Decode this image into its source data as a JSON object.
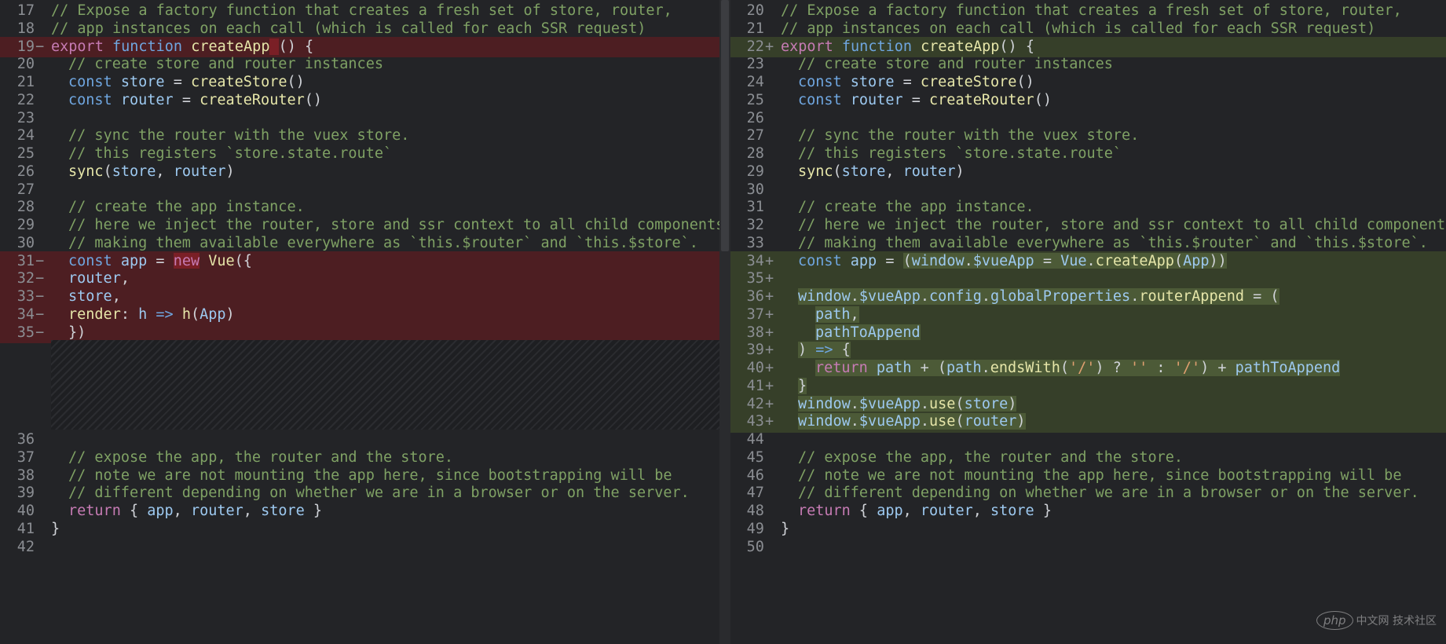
{
  "left": {
    "lines": [
      {
        "n": "17",
        "mark": "",
        "type": "ctx",
        "html": "<span class='c'>// Expose a factory function that creates a fresh set of store, router,</span>"
      },
      {
        "n": "18",
        "mark": "",
        "type": "ctx",
        "html": "<span class='c'>// app instances on each call (which is called for each SSR request)</span>"
      },
      {
        "n": "19",
        "mark": "−",
        "type": "del",
        "html": "<span class='k'>export</span> <span class='f'>function</span> <span class='fn'>createApp</span><span class='hl-del'> </span><span class='p'>() {</span>"
      },
      {
        "n": "20",
        "mark": "",
        "type": "ctx",
        "html": "<span class='ind'></span><span class='c'>// create store and router instances</span>"
      },
      {
        "n": "21",
        "mark": "",
        "type": "ctx",
        "html": "<span class='ind'></span><span class='f'>const</span> <span class='v'>store</span> <span class='p'>=</span> <span class='fn'>createStore</span><span class='p'>()</span>"
      },
      {
        "n": "22",
        "mark": "",
        "type": "ctx",
        "html": "<span class='ind'></span><span class='f'>const</span> <span class='v'>router</span> <span class='p'>=</span> <span class='fn'>createRouter</span><span class='p'>()</span>"
      },
      {
        "n": "23",
        "mark": "",
        "type": "ctx",
        "html": ""
      },
      {
        "n": "24",
        "mark": "",
        "type": "ctx",
        "html": "<span class='ind'></span><span class='c'>// sync the router with the vuex store.</span>"
      },
      {
        "n": "25",
        "mark": "",
        "type": "ctx",
        "html": "<span class='ind'></span><span class='c'>// this registers `store.state.route`</span>"
      },
      {
        "n": "26",
        "mark": "",
        "type": "ctx",
        "html": "<span class='ind'></span><span class='fn'>sync</span><span class='p'>(</span><span class='v'>store</span><span class='p'>, </span><span class='v'>router</span><span class='p'>)</span>"
      },
      {
        "n": "27",
        "mark": "",
        "type": "ctx",
        "html": ""
      },
      {
        "n": "28",
        "mark": "",
        "type": "ctx",
        "html": "<span class='ind'></span><span class='c'>// create the app instance.</span>"
      },
      {
        "n": "29",
        "mark": "",
        "type": "ctx",
        "html": "<span class='ind'></span><span class='c'>// here we inject the router, store and ssr context to all child components,</span>"
      },
      {
        "n": "30",
        "mark": "",
        "type": "ctx",
        "html": "<span class='ind'></span><span class='c'>// making them available everywhere as `this.$router` and `this.$store`.</span>"
      },
      {
        "n": "31",
        "mark": "−",
        "type": "del",
        "html": "<span class='ind'></span><span class='f'>const</span> <span class='v'>app</span> <span class='p'>=</span> <span class='hl-del'><span class='k'>new</span></span> <span class='fn'>Vue</span><span class='p'>({</span>"
      },
      {
        "n": "32",
        "mark": "−",
        "type": "del",
        "html": "<span class='ind hl-del'></span><span class='v'>router</span><span class='p'>,</span>"
      },
      {
        "n": "33",
        "mark": "−",
        "type": "del",
        "html": "<span class='ind hl-del'></span><span class='v'>store</span><span class='p'>,</span>"
      },
      {
        "n": "34",
        "mark": "−",
        "type": "del",
        "html": "<span class='ind hl-del'></span><span class='fn'>render</span><span class='p'>: </span><span class='v'>h</span> <span class='f'>=&gt;</span> <span class='fn'>h</span><span class='p'>(</span><span class='v'>App</span><span class='p'>)</span>"
      },
      {
        "n": "35",
        "mark": "−",
        "type": "del",
        "html": "<span class='ind'></span><span class='p'>})</span>"
      },
      {
        "n": "",
        "mark": "",
        "type": "gap",
        "html": ""
      },
      {
        "n": "",
        "mark": "",
        "type": "gap",
        "html": ""
      },
      {
        "n": "",
        "mark": "",
        "type": "gap",
        "html": ""
      },
      {
        "n": "",
        "mark": "",
        "type": "gap",
        "html": ""
      },
      {
        "n": "",
        "mark": "",
        "type": "gap",
        "html": ""
      },
      {
        "n": "36",
        "mark": "",
        "type": "ctx",
        "html": ""
      },
      {
        "n": "37",
        "mark": "",
        "type": "ctx",
        "html": "<span class='ind'></span><span class='c'>// expose the app, the router and the store.</span>"
      },
      {
        "n": "38",
        "mark": "",
        "type": "ctx",
        "html": "<span class='ind'></span><span class='c'>// note we are not mounting the app here, since bootstrapping will be</span>"
      },
      {
        "n": "39",
        "mark": "",
        "type": "ctx",
        "html": "<span class='ind'></span><span class='c'>// different depending on whether we are in a browser or on the server.</span>"
      },
      {
        "n": "40",
        "mark": "",
        "type": "ctx",
        "html": "<span class='ind'></span><span class='k'>return</span> <span class='p'>{ </span><span class='v'>app</span><span class='p'>, </span><span class='v'>router</span><span class='p'>, </span><span class='v'>store</span><span class='p'> }</span>"
      },
      {
        "n": "41",
        "mark": "",
        "type": "ctx",
        "html": "<span class='p'>}</span>"
      },
      {
        "n": "42",
        "mark": "",
        "type": "ctx",
        "html": ""
      }
    ]
  },
  "right": {
    "lines": [
      {
        "n": "20",
        "mark": "",
        "type": "ctx",
        "html": "<span class='c'>// Expose a factory function that creates a fresh set of store, router,</span>"
      },
      {
        "n": "21",
        "mark": "",
        "type": "ctx",
        "html": "<span class='c'>// app instances on each call (which is called for each SSR request)</span>"
      },
      {
        "n": "22",
        "mark": "+",
        "type": "add",
        "html": "<span class='k'>export</span> <span class='f'>function</span> <span class='fn'>createApp</span><span class='p'>() {</span>"
      },
      {
        "n": "23",
        "mark": "",
        "type": "ctx",
        "html": "<span class='ind'></span><span class='c'>// create store and router instances</span>"
      },
      {
        "n": "24",
        "mark": "",
        "type": "ctx",
        "html": "<span class='ind'></span><span class='f'>const</span> <span class='v'>store</span> <span class='p'>=</span> <span class='fn'>createStore</span><span class='p'>()</span>"
      },
      {
        "n": "25",
        "mark": "",
        "type": "ctx",
        "html": "<span class='ind'></span><span class='f'>const</span> <span class='v'>router</span> <span class='p'>=</span> <span class='fn'>createRouter</span><span class='p'>()</span>"
      },
      {
        "n": "26",
        "mark": "",
        "type": "ctx",
        "html": ""
      },
      {
        "n": "27",
        "mark": "",
        "type": "ctx",
        "html": "<span class='ind'></span><span class='c'>// sync the router with the vuex store.</span>"
      },
      {
        "n": "28",
        "mark": "",
        "type": "ctx",
        "html": "<span class='ind'></span><span class='c'>// this registers `store.state.route`</span>"
      },
      {
        "n": "29",
        "mark": "",
        "type": "ctx",
        "html": "<span class='ind'></span><span class='fn'>sync</span><span class='p'>(</span><span class='v'>store</span><span class='p'>, </span><span class='v'>router</span><span class='p'>)</span>"
      },
      {
        "n": "30",
        "mark": "",
        "type": "ctx",
        "html": ""
      },
      {
        "n": "31",
        "mark": "",
        "type": "ctx",
        "html": "<span class='ind'></span><span class='c'>// create the app instance.</span>"
      },
      {
        "n": "32",
        "mark": "",
        "type": "ctx",
        "html": "<span class='ind'></span><span class='c'>// here we inject the router, store and ssr context to all child components,</span>"
      },
      {
        "n": "33",
        "mark": "",
        "type": "ctx",
        "html": "<span class='ind'></span><span class='c'>// making them available everywhere as `this.$router` and `this.$store`.</span>"
      },
      {
        "n": "34",
        "mark": "+",
        "type": "add",
        "html": "<span class='ind'></span><span class='f'>const</span> <span class='v'>app</span> <span class='p'>=</span> <span class='hl-add'><span class='p'>(</span><span class='v'>window</span><span class='p'>.</span><span class='v'>$vueApp</span> <span class='p'>=</span> <span class='v'>Vue</span><span class='p'>.</span><span class='fn'>createApp</span><span class='p'>(</span><span class='v'>App</span><span class='p'>))</span></span>"
      },
      {
        "n": "35",
        "mark": "+",
        "type": "add",
        "html": ""
      },
      {
        "n": "36",
        "mark": "+",
        "type": "add",
        "html": "<span class='ind'></span><span class='hl-add'><span class='v'>window</span><span class='p'>.</span><span class='v'>$vueApp</span><span class='p'>.</span><span class='v'>config</span><span class='p'>.</span><span class='v'>globalProperties</span><span class='p'>.</span><span class='fn'>routerAppend</span> <span class='p'>= (</span></span>"
      },
      {
        "n": "37",
        "mark": "+",
        "type": "add",
        "html": "<span class='ind'></span><span class='ind hl-add'></span><span class='hl-add'><span class='v'>path</span><span class='p'>,</span></span>"
      },
      {
        "n": "38",
        "mark": "+",
        "type": "add",
        "html": "<span class='ind'></span><span class='ind hl-add'></span><span class='hl-add'><span class='v'>pathToAppend</span></span>"
      },
      {
        "n": "39",
        "mark": "+",
        "type": "add",
        "html": "<span class='ind'></span><span class='hl-add'><span class='p'>) </span><span class='f'>=&gt;</span><span class='p'> {</span></span>"
      },
      {
        "n": "40",
        "mark": "+",
        "type": "add",
        "html": "<span class='ind'></span><span class='ind hl-add'></span><span class='hl-add'><span class='k'>return</span> <span class='v'>path</span> <span class='p'>+ (</span><span class='v'>path</span><span class='p'>.</span><span class='fn'>endsWith</span><span class='p'>(</span><span class='s'>'/'</span><span class='p'>) ? </span><span class='s'>''</span><span class='p'> : </span><span class='s'>'/'</span><span class='p'>) + </span><span class='v'>pathToAppend</span></span>"
      },
      {
        "n": "41",
        "mark": "+",
        "type": "add",
        "html": "<span class='ind'></span><span class='hl-add'><span class='p'>}</span></span>"
      },
      {
        "n": "42",
        "mark": "+",
        "type": "add",
        "html": "<span class='ind'></span><span class='hl-add'><span class='v'>window</span><span class='p'>.</span><span class='v'>$vueApp</span><span class='p'>.</span><span class='fn'>use</span><span class='p'>(</span><span class='v'>store</span><span class='p'>)</span></span>"
      },
      {
        "n": "43",
        "mark": "+",
        "type": "add",
        "html": "<span class='ind'></span><span class='hl-add'><span class='v'>window</span><span class='p'>.</span><span class='v'>$vueApp</span><span class='p'>.</span><span class='fn'>use</span><span class='p'>(</span><span class='v'>router</span><span class='p'>)</span></span>"
      },
      {
        "n": "44",
        "mark": "",
        "type": "ctx",
        "html": ""
      },
      {
        "n": "45",
        "mark": "",
        "type": "ctx",
        "html": "<span class='ind'></span><span class='c'>// expose the app, the router and the store.</span>"
      },
      {
        "n": "46",
        "mark": "",
        "type": "ctx",
        "html": "<span class='ind'></span><span class='c'>// note we are not mounting the app here, since bootstrapping will be</span>"
      },
      {
        "n": "47",
        "mark": "",
        "type": "ctx",
        "html": "<span class='ind'></span><span class='c'>// different depending on whether we are in a browser or on the server.</span>"
      },
      {
        "n": "48",
        "mark": "",
        "type": "ctx",
        "html": "<span class='ind'></span><span class='k'>return</span> <span class='p'>{ </span><span class='v'>app</span><span class='p'>, </span><span class='v'>router</span><span class='p'>, </span><span class='v'>store</span><span class='p'> }</span>"
      },
      {
        "n": "49",
        "mark": "",
        "type": "ctx",
        "html": "<span class='p'>}</span>"
      },
      {
        "n": "50",
        "mark": "",
        "type": "ctx",
        "html": ""
      }
    ]
  },
  "watermark": {
    "logo": "php",
    "text": "中文网 技术社区"
  },
  "colors": {
    "deleted_bg": "#4d1e22",
    "added_bg": "#363f29",
    "comment": "#7fa164",
    "keyword": "#c67bb4"
  }
}
